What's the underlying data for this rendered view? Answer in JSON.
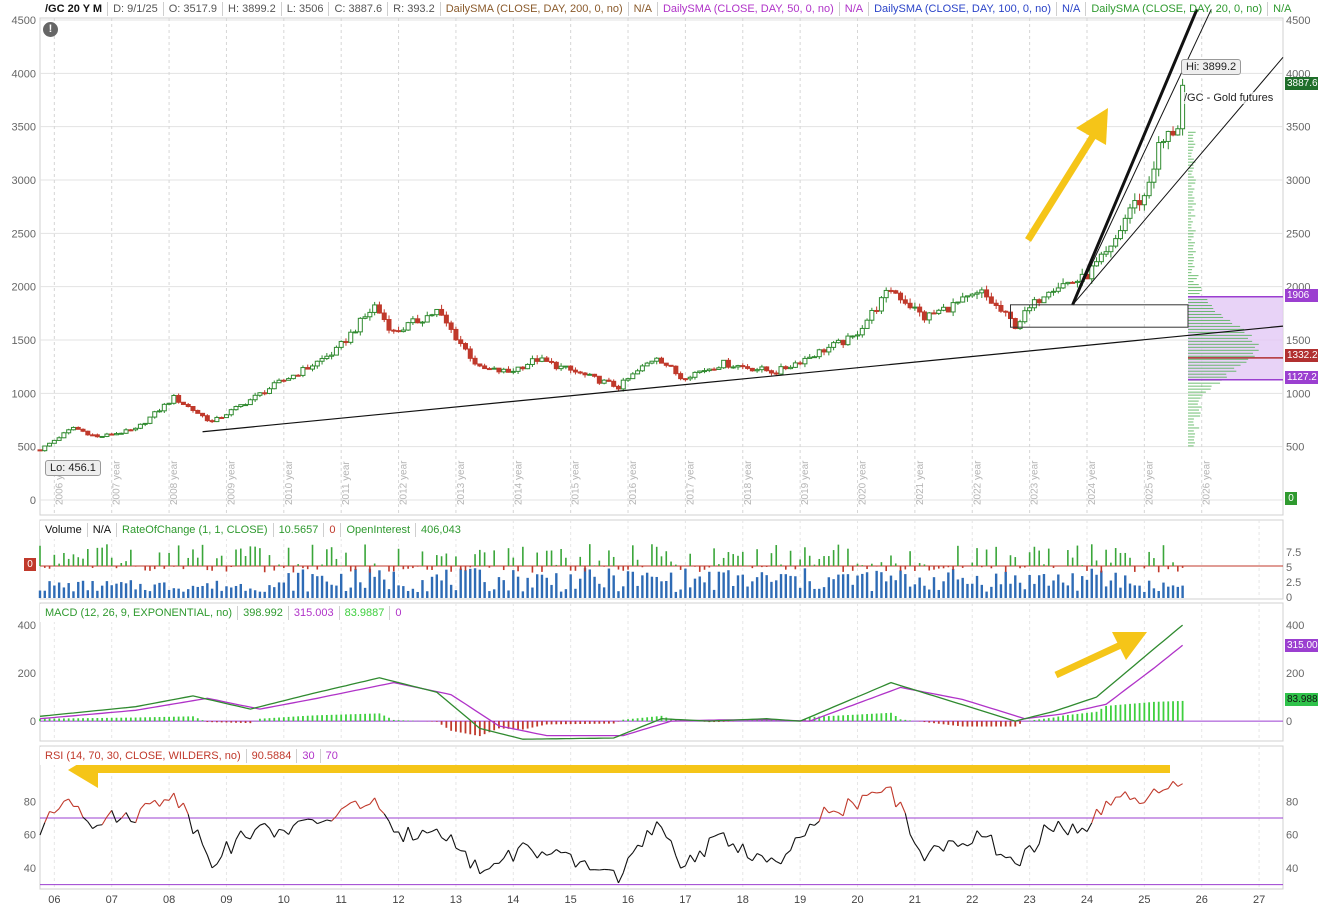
{
  "header": {
    "symbol": "/GC 20 Y M",
    "date": "D: 9/1/25",
    "open": "O: 3517.9",
    "high": "H: 3899.2",
    "low": "L: 3506",
    "close": "C: 3887.6",
    "range": "R: 393.2",
    "sma200": "DailySMA (CLOSE, DAY, 200, 0, no)",
    "sma200_val": "N/A",
    "sma50": "DailySMA (CLOSE, DAY, 50, 0, no)",
    "sma50_val": "N/A",
    "sma100": "DailySMA (CLOSE, DAY, 100, 0, no)",
    "sma100_val": "N/A",
    "sma20": "DailySMA (CLOSE, DAY, 20, 0, no)",
    "sma20_val": "N/A"
  },
  "volume_header": {
    "label": "Volume",
    "value": "N/A",
    "roc": "RateOfChange (1, 1, CLOSE)",
    "roc_val": "10.5657",
    "roc_zero": "0",
    "oi": "OpenInterest",
    "oi_val": "406,043"
  },
  "macd_header": {
    "label": "MACD (12, 26, 9, EXPONENTIAL, no)",
    "value": "398.992",
    "avg": "315.003",
    "diff": "83.9887",
    "zero": "0"
  },
  "rsi_header": {
    "label": "RSI (14, 70, 30, CLOSE, WILDERS, no)",
    "value": "90.5884",
    "oversold": "30",
    "overbought": "70"
  },
  "annotations": {
    "hi": "Hi: 3899.2",
    "lo": "Lo: 456.1",
    "name": "/GC - Gold futures",
    "last": "3887.6",
    "zero": "0",
    "vp_high": "1906",
    "vp_poc": "1332.2",
    "vp_low": "1127.2",
    "macd_avg_badge": "315.003",
    "macd_diff_badge": "83.9887"
  },
  "colors": {
    "up": "#2f8a2f",
    "down": "#c0392b",
    "macd": "#2f8a2f",
    "avg": "#b033c8",
    "rsi_line": "#111111",
    "rsi_over": "#c0392b",
    "accent_arrow": "#f5c518",
    "grid": "#e3e3e3"
  },
  "chart_data": [
    {
      "type": "candlestick",
      "title": "/GC 20 Y M",
      "ylim": [
        0,
        4500
      ],
      "y_ticks": [
        "0",
        "500",
        "1000",
        "1500",
        "2000",
        "2500",
        "3000",
        "3500",
        "4000",
        "4500"
      ],
      "year_labels": [
        "2006 year",
        "2007 year",
        "2008 year",
        "2009 year",
        "2010 year",
        "2011 year",
        "2012 year",
        "2013 year",
        "2014 year",
        "2015 year",
        "2016 year",
        "2017 year",
        "2018 year",
        "2019 year",
        "2020 year",
        "2021 year",
        "2022 year",
        "2023 year",
        "2024 year",
        "2025 year",
        "2026 year"
      ],
      "x_range": [
        "2005-10",
        "2027-06"
      ],
      "close_anchors": [
        {
          "x": "2005-10",
          "v": 470
        },
        {
          "x": "2006-05",
          "v": 680
        },
        {
          "x": "2006-10",
          "v": 590
        },
        {
          "x": "2007-06",
          "v": 660
        },
        {
          "x": "2008-02",
          "v": 960
        },
        {
          "x": "2008-10",
          "v": 730
        },
        {
          "x": "2009-06",
          "v": 940
        },
        {
          "x": "2009-12",
          "v": 1100
        },
        {
          "x": "2010-06",
          "v": 1240
        },
        {
          "x": "2010-12",
          "v": 1400
        },
        {
          "x": "2011-08",
          "v": 1820
        },
        {
          "x": "2011-12",
          "v": 1570
        },
        {
          "x": "2012-09",
          "v": 1770
        },
        {
          "x": "2013-06",
          "v": 1230
        },
        {
          "x": "2013-12",
          "v": 1200
        },
        {
          "x": "2014-06",
          "v": 1320
        },
        {
          "x": "2015-11",
          "v": 1060
        },
        {
          "x": "2016-07",
          "v": 1350
        },
        {
          "x": "2016-12",
          "v": 1150
        },
        {
          "x": "2017-09",
          "v": 1280
        },
        {
          "x": "2018-08",
          "v": 1200
        },
        {
          "x": "2019-06",
          "v": 1410
        },
        {
          "x": "2019-12",
          "v": 1520
        },
        {
          "x": "2020-08",
          "v": 1980
        },
        {
          "x": "2021-03",
          "v": 1710
        },
        {
          "x": "2022-03",
          "v": 1940
        },
        {
          "x": "2022-10",
          "v": 1640
        },
        {
          "x": "2023-05",
          "v": 1990
        },
        {
          "x": "2023-12",
          "v": 2070
        },
        {
          "x": "2024-06",
          "v": 2340
        },
        {
          "x": "2024-10",
          "v": 2740
        },
        {
          "x": "2025-01",
          "v": 2840
        },
        {
          "x": "2025-04",
          "v": 3300
        },
        {
          "x": "2025-08",
          "v": 3520
        },
        {
          "x": "2025-09",
          "v": 3887.6
        }
      ],
      "hi": 3899.2,
      "lo": 456.1,
      "levels": [
        1906,
        1332.2,
        1127.2
      ]
    },
    {
      "type": "line",
      "title": "MACD (12, 26, 9, EXPONENTIAL, no)",
      "ylim": [
        -70,
        420
      ],
      "y_ticks": [
        "0",
        "200",
        "400"
      ],
      "macd_anchors": [
        {
          "x": "2005-10",
          "v": 20
        },
        {
          "x": "2007-06",
          "v": 60
        },
        {
          "x": "2008-06",
          "v": 105
        },
        {
          "x": "2009-06",
          "v": 50
        },
        {
          "x": "2010-06",
          "v": 110
        },
        {
          "x": "2011-09",
          "v": 180
        },
        {
          "x": "2012-09",
          "v": 120
        },
        {
          "x": "2013-06",
          "v": -30
        },
        {
          "x": "2014-03",
          "v": -75
        },
        {
          "x": "2015-10",
          "v": -70
        },
        {
          "x": "2016-08",
          "v": 10
        },
        {
          "x": "2017-06",
          "v": 0
        },
        {
          "x": "2018-06",
          "v": 10
        },
        {
          "x": "2019-01",
          "v": 0
        },
        {
          "x": "2020-08",
          "v": 160
        },
        {
          "x": "2021-09",
          "v": 80
        },
        {
          "x": "2022-10",
          "v": 0
        },
        {
          "x": "2023-06",
          "v": 40
        },
        {
          "x": "2024-03",
          "v": 100
        },
        {
          "x": "2025-03",
          "v": 300
        },
        {
          "x": "2025-09",
          "v": 398.992
        }
      ],
      "avg_anchors": [
        {
          "x": "2005-10",
          "v": 10
        },
        {
          "x": "2007-06",
          "v": 45
        },
        {
          "x": "2008-09",
          "v": 95
        },
        {
          "x": "2009-08",
          "v": 50
        },
        {
          "x": "2010-08",
          "v": 95
        },
        {
          "x": "2011-12",
          "v": 160
        },
        {
          "x": "2012-12",
          "v": 110
        },
        {
          "x": "2013-10",
          "v": -20
        },
        {
          "x": "2014-08",
          "v": -60
        },
        {
          "x": "2015-12",
          "v": -60
        },
        {
          "x": "2016-10",
          "v": 0
        },
        {
          "x": "2017-08",
          "v": 5
        },
        {
          "x": "2018-08",
          "v": 5
        },
        {
          "x": "2019-03",
          "v": 0
        },
        {
          "x": "2020-10",
          "v": 140
        },
        {
          "x": "2021-11",
          "v": 90
        },
        {
          "x": "2022-12",
          "v": 10
        },
        {
          "x": "2023-08",
          "v": 30
        },
        {
          "x": "2024-05",
          "v": 70
        },
        {
          "x": "2025-03",
          "v": 220
        },
        {
          "x": "2025-09",
          "v": 315.003
        }
      ]
    },
    {
      "type": "line",
      "title": "RSI (14, 70, 30, CLOSE, WILDERS, no)",
      "ylim": [
        28,
        100
      ],
      "y_ticks": [
        "40",
        "60",
        "80"
      ],
      "levels": [
        30,
        70
      ],
      "rsi_anchors": [
        {
          "x": "2005-10",
          "v": 62
        },
        {
          "x": "2006-04",
          "v": 84
        },
        {
          "x": "2006-09",
          "v": 68
        },
        {
          "x": "2007-06",
          "v": 72
        },
        {
          "x": "2008-02",
          "v": 86
        },
        {
          "x": "2008-10",
          "v": 45
        },
        {
          "x": "2009-06",
          "v": 62
        },
        {
          "x": "2010-06",
          "v": 65
        },
        {
          "x": "2011-08",
          "v": 82
        },
        {
          "x": "2011-12",
          "v": 57
        },
        {
          "x": "2012-09",
          "v": 66
        },
        {
          "x": "2013-06",
          "v": 38
        },
        {
          "x": "2014-03",
          "v": 52
        },
        {
          "x": "2015-11",
          "v": 36
        },
        {
          "x": "2016-07",
          "v": 65
        },
        {
          "x": "2016-12",
          "v": 43
        },
        {
          "x": "2017-09",
          "v": 58
        },
        {
          "x": "2018-08",
          "v": 41
        },
        {
          "x": "2019-06",
          "v": 72
        },
        {
          "x": "2020-08",
          "v": 87
        },
        {
          "x": "2021-03",
          "v": 46
        },
        {
          "x": "2022-03",
          "v": 62
        },
        {
          "x": "2022-10",
          "v": 39
        },
        {
          "x": "2023-05",
          "v": 65
        },
        {
          "x": "2023-12",
          "v": 63
        },
        {
          "x": "2024-06",
          "v": 78
        },
        {
          "x": "2024-10",
          "v": 84
        },
        {
          "x": "2025-01",
          "v": 76
        },
        {
          "x": "2025-04",
          "v": 86
        },
        {
          "x": "2025-09",
          "v": 90.5884
        }
      ]
    }
  ],
  "time_axis": [
    "06",
    "07",
    "08",
    "09",
    "10",
    "11",
    "12",
    "13",
    "14",
    "15",
    "16",
    "17",
    "18",
    "19",
    "20",
    "21",
    "22",
    "23",
    "24",
    "25",
    "26",
    "27"
  ],
  "volume_ticks": [
    "7.5",
    "5",
    "2.5",
    "0"
  ],
  "volume_zero_badge": "0"
}
